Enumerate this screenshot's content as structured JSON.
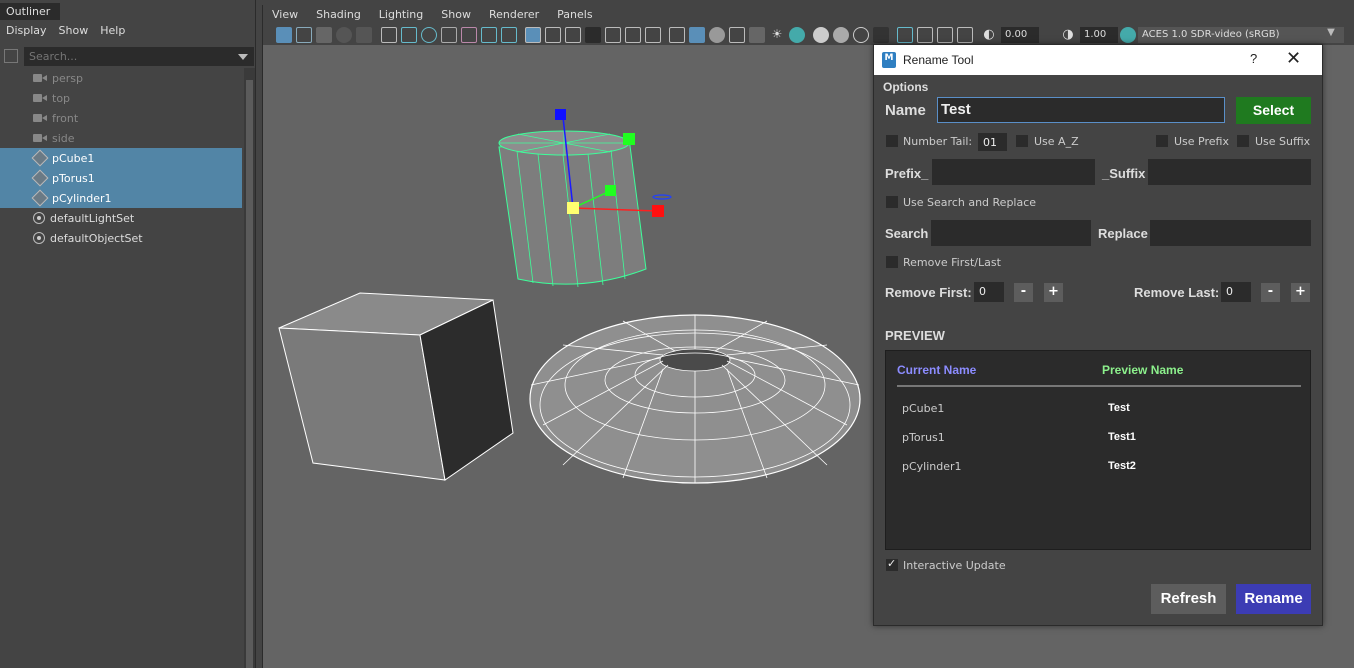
{
  "outliner": {
    "title": "Outliner",
    "menu": [
      "Display",
      "Show",
      "Help"
    ],
    "search_placeholder": "Search...",
    "items": [
      {
        "label": "persp",
        "kind": "camera",
        "selected": false
      },
      {
        "label": "top",
        "kind": "camera",
        "selected": false
      },
      {
        "label": "front",
        "kind": "camera",
        "selected": false
      },
      {
        "label": "side",
        "kind": "camera",
        "selected": false
      },
      {
        "label": "pCube1",
        "kind": "mesh",
        "selected": true
      },
      {
        "label": "pTorus1",
        "kind": "mesh",
        "selected": true
      },
      {
        "label": "pCylinder1",
        "kind": "mesh",
        "selected": true
      },
      {
        "label": "defaultLightSet",
        "kind": "set",
        "selected": false
      },
      {
        "label": "defaultObjectSet",
        "kind": "set",
        "selected": false
      }
    ]
  },
  "viewport": {
    "menu": [
      "View",
      "Shading",
      "Lighting",
      "Show",
      "Renderer",
      "Panels"
    ],
    "exposure": "0.00",
    "gamma": "1.00",
    "colorspace": "ACES 1.0 SDR-video (sRGB)"
  },
  "dialog": {
    "title": "Rename Tool",
    "help": "?",
    "close": "✕",
    "options_label": "Options",
    "name_label": "Name",
    "name_value": "Test",
    "select_button": "Select",
    "number_tail_label": "Number Tail:",
    "number_tail_value": "01",
    "use_az_label": "Use A_Z",
    "use_prefix_label": "Use Prefix",
    "use_suffix_label": "Use Suffix",
    "prefix_label": "Prefix_",
    "suffix_label": "_Suffix",
    "use_search_replace_label": "Use Search and Replace",
    "search_label": "Search",
    "replace_label": "Replace",
    "remove_first_last_label": "Remove First/Last",
    "remove_first_label": "Remove First:",
    "remove_first_value": "0",
    "remove_last_label": "Remove Last:",
    "remove_last_value": "0",
    "minus": "-",
    "plus": "+",
    "preview_title": "PREVIEW",
    "preview_headers": {
      "current": "Current Name",
      "preview": "Preview Name"
    },
    "preview_rows": [
      {
        "current": "pCube1",
        "preview": "Test"
      },
      {
        "current": "pTorus1",
        "preview": "Test1"
      },
      {
        "current": "pCylinder1",
        "preview": "Test2"
      }
    ],
    "interactive_update_label": "Interactive Update",
    "interactive_update_checked": true,
    "refresh_button": "Refresh",
    "rename_button": "Rename",
    "colors": {
      "select": "#1f7a1f",
      "rename": "#3c3cb4",
      "current_header": "#8c8cff",
      "preview_header": "#8cf08c"
    }
  }
}
